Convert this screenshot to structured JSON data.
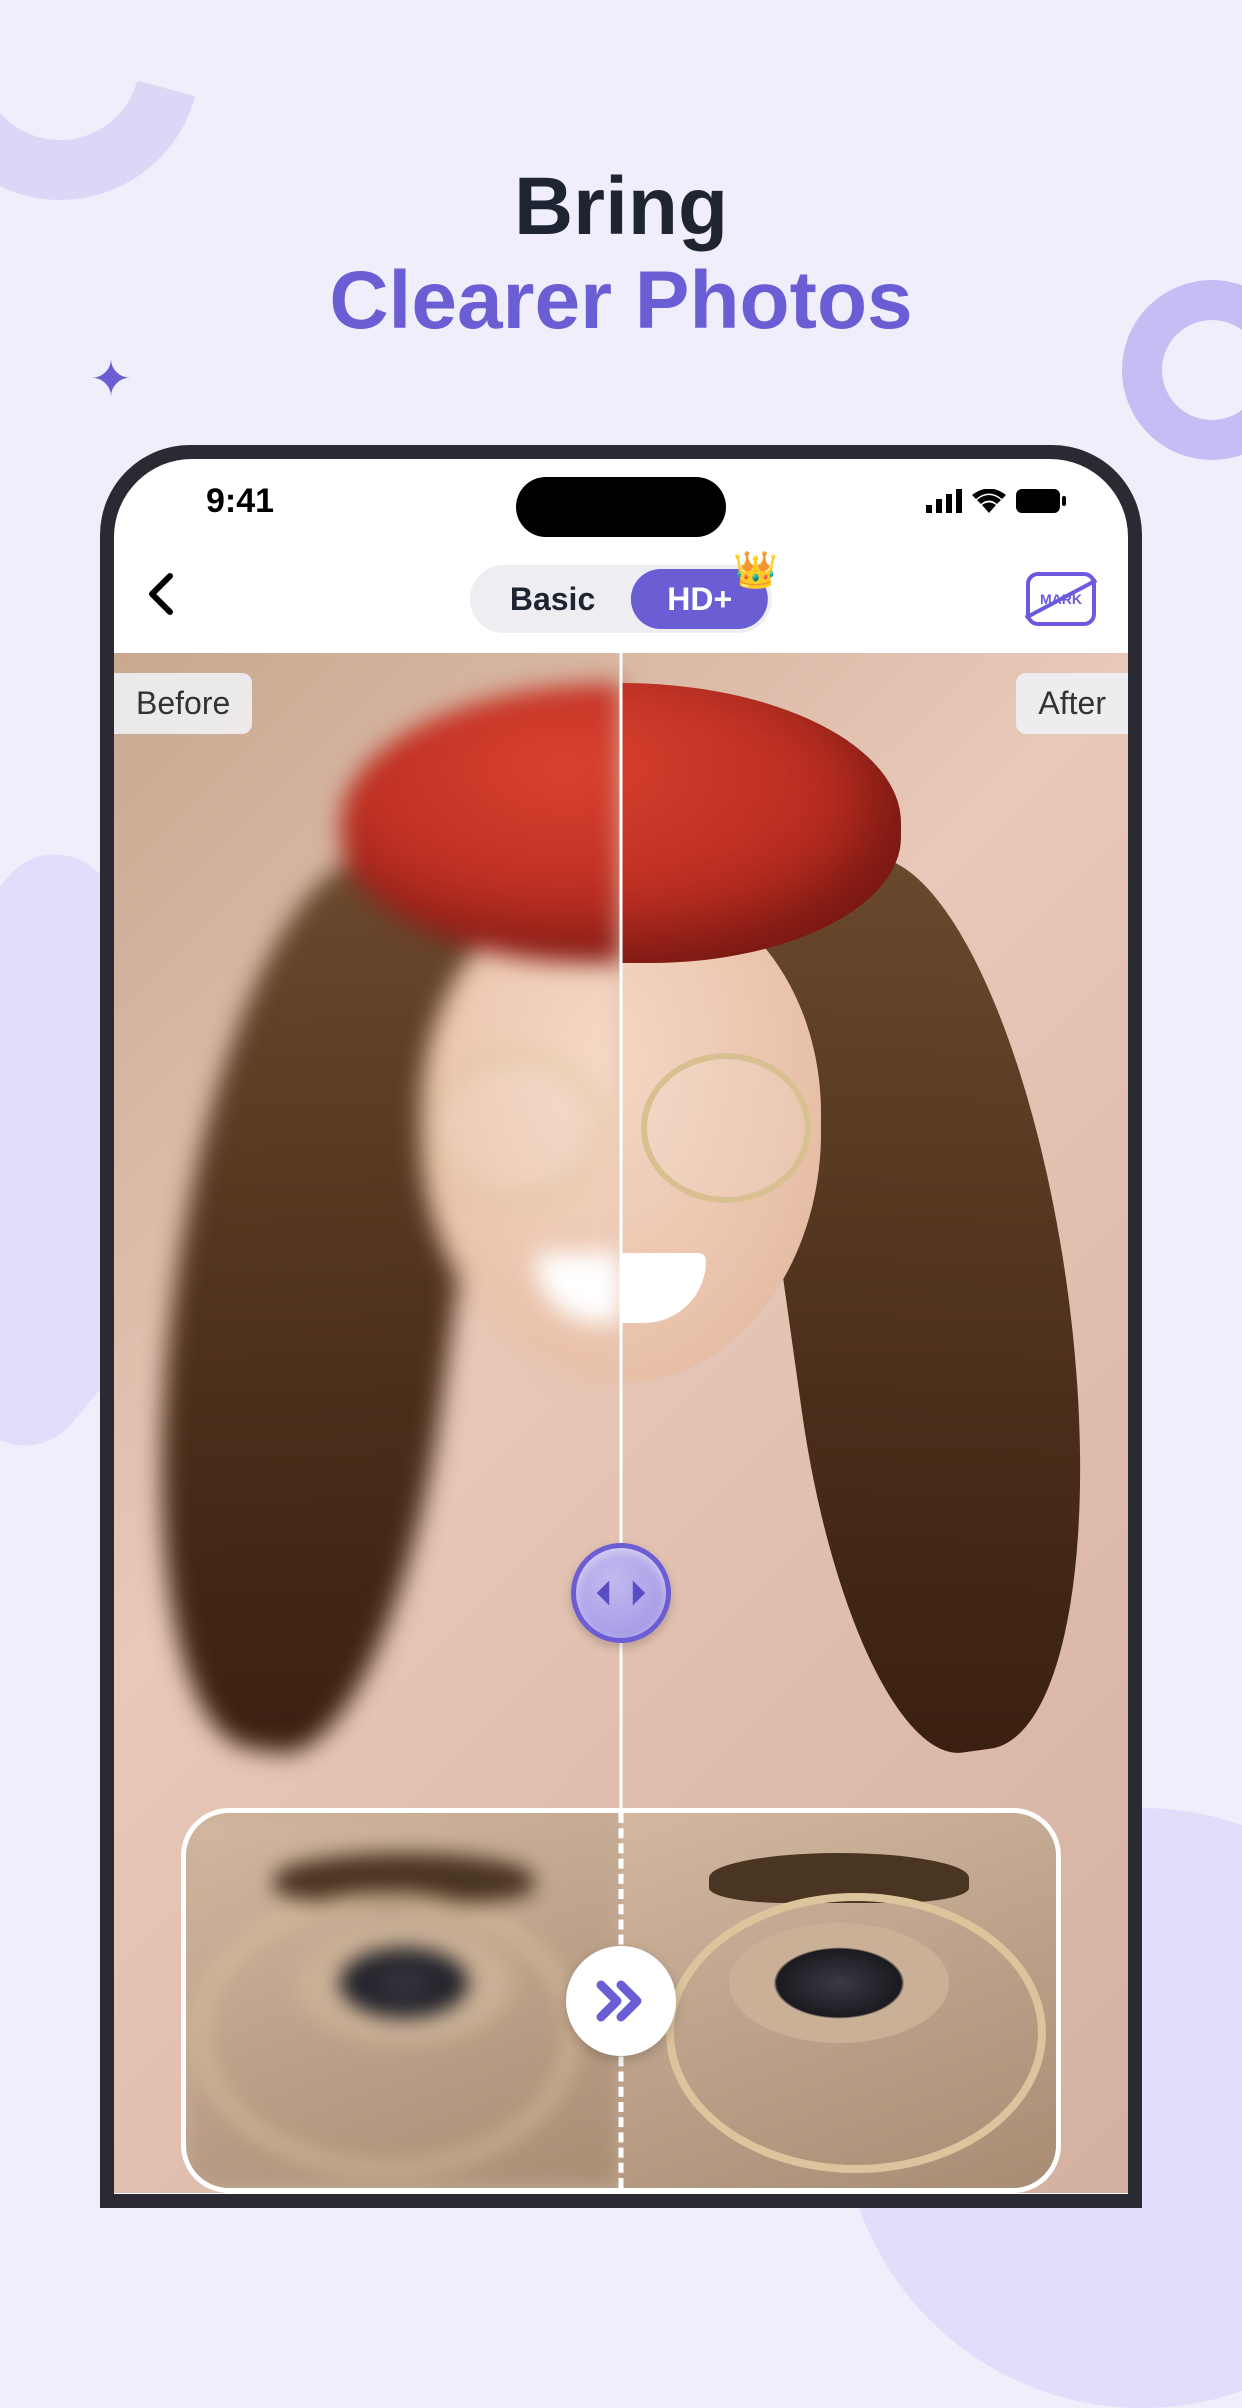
{
  "headline": {
    "line1": "Bring",
    "line2": "Clearer Photos"
  },
  "status": {
    "time": "9:41"
  },
  "nav": {
    "segment_basic": "Basic",
    "segment_hd": "HD+",
    "watermark_label": "MARK"
  },
  "labels": {
    "before": "Before",
    "after": "After"
  },
  "colors": {
    "accent": "#6b5dd3",
    "bg": "#f0eefb"
  }
}
